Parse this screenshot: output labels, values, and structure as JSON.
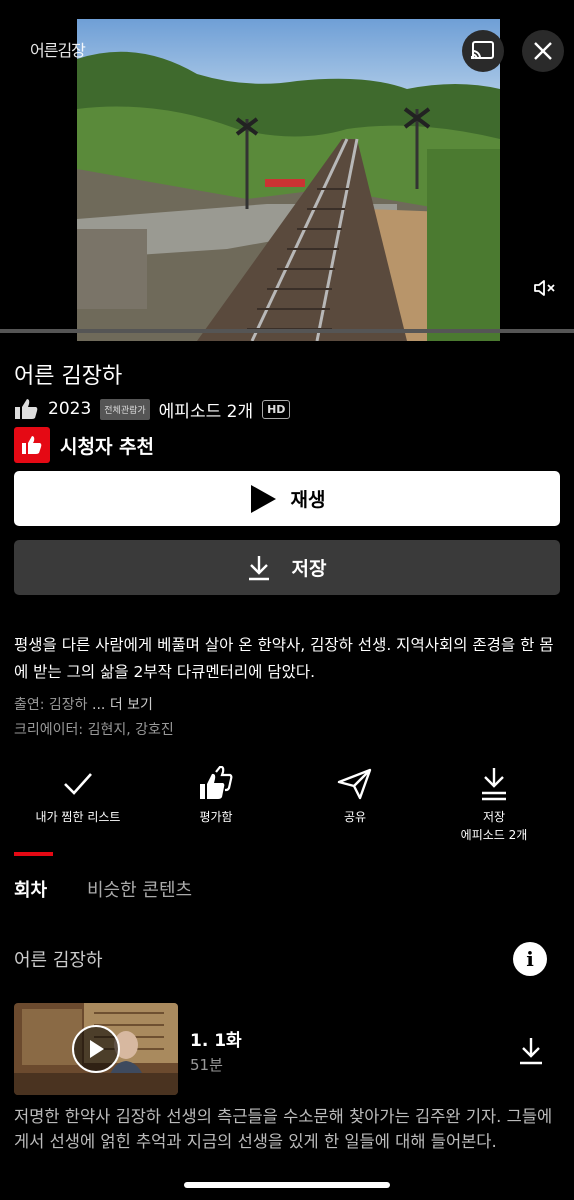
{
  "player": {
    "brand": "어른김장",
    "icons": {
      "cast": "cast-icon",
      "close": "close-icon",
      "mute": "volume-mute-icon"
    }
  },
  "title": {
    "text": "어른 김장하"
  },
  "meta": {
    "year": "2023",
    "rating": "전체관람가",
    "episodes": "에피소드 2개",
    "quality": "HD"
  },
  "recommendation": {
    "label": "시청자 추천"
  },
  "buttons": {
    "play_label": "재생",
    "save_label": "저장"
  },
  "synopsis": "평생을 다른 사람에게 베풀며 살아 온 한약사, 김장하 선생. 지역사회의 존경을 한 몸에 받는 그의 삶을 2부작 다큐멘터리에 담았다.",
  "credits": {
    "cast_prefix": "출연: 김장하",
    "cast_more": " ... 더 보기",
    "creators": "크리에이터: 김현지, 강호진"
  },
  "actions": {
    "my_list": "내가 찜한 리스트",
    "rate": "평가함",
    "share": "공유",
    "download_line1": "저장",
    "download_line2": "에피소드 2개"
  },
  "tabs": {
    "episodes": "회차",
    "similar": "비슷한 콘텐츠"
  },
  "season": {
    "title": "어른 김장하"
  },
  "episode": {
    "title": "1. 1화",
    "duration": "51분",
    "description": "저명한 한약사 김장하 선생의 측근들을 수소문해 찾아가는 김주완 기자. 그들에게서 선생에 얽힌 추억과 지금의 선생을 있게 한 일들에 대해 들어본다."
  },
  "colors": {
    "accent": "#e50914",
    "background": "#000000",
    "play_button": "#ffffff",
    "save_button": "#3a3a3a"
  }
}
